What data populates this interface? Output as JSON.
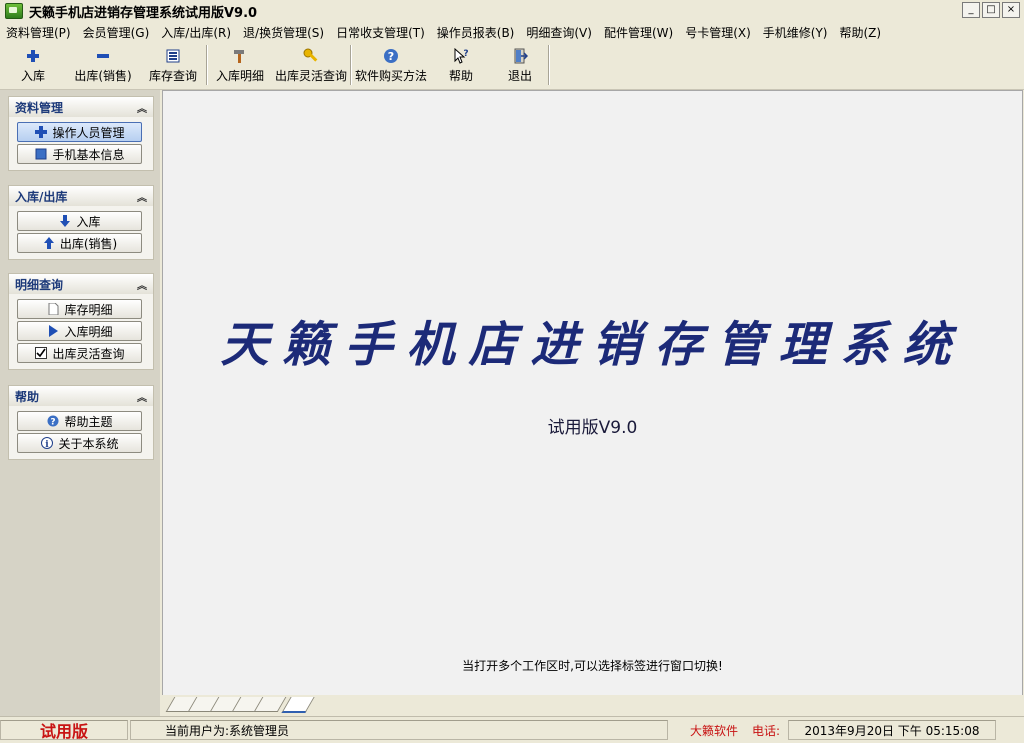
{
  "window": {
    "title": "天籁手机店进销存管理系统试用版V9.0",
    "controls": [
      "_",
      "□",
      "×"
    ]
  },
  "menu": {
    "items": [
      "资料管理(P)",
      "会员管理(G)",
      "入库/出库(R)",
      "退/换货管理(S)",
      "日常收支管理(T)",
      "操作员报表(B)",
      "明细查询(V)",
      "配件管理(W)",
      "号卡管理(X)",
      "手机维修(Y)",
      "帮助(Z)"
    ]
  },
  "toolbar": {
    "buttons": [
      {
        "label": "入库",
        "icon": "plus-icon"
      },
      {
        "label": "出库(销售)",
        "icon": "minus-icon"
      },
      {
        "label": "库存查询",
        "icon": "list-icon"
      },
      {
        "label": "入库明细",
        "icon": "hammer-icon"
      },
      {
        "label": "出库灵活查询",
        "icon": "key-icon"
      },
      {
        "label": "软件购买方法",
        "icon": "help-circle-icon"
      },
      {
        "label": "帮助",
        "icon": "cursor-help-icon"
      },
      {
        "label": "退出",
        "icon": "exit-icon"
      }
    ]
  },
  "sidebar": {
    "panels": [
      {
        "title": "资料管理",
        "items": [
          {
            "label": "操作人员管理",
            "icon": "plus-icon"
          },
          {
            "label": "手机基本信息",
            "icon": "square-icon"
          }
        ]
      },
      {
        "title": "入库/出库",
        "items": [
          {
            "label": "入库",
            "icon": "arrow-down-icon"
          },
          {
            "label": "出库(销售)",
            "icon": "arrow-up-icon"
          }
        ]
      },
      {
        "title": "明细查询",
        "items": [
          {
            "label": "库存明细",
            "icon": "document-icon"
          },
          {
            "label": "入库明细",
            "icon": "arrow-right-icon"
          },
          {
            "label": "出库灵活查询",
            "icon": "checkbox-icon"
          }
        ]
      },
      {
        "title": "帮助",
        "items": [
          {
            "label": "帮助主题",
            "icon": "help-circle-icon"
          },
          {
            "label": "关于本系统",
            "icon": "info-icon"
          }
        ]
      }
    ]
  },
  "main": {
    "title": "天籁手机店进销存管理系统",
    "version": "试用版V9.0",
    "hint": "当打开多个工作区时,可以选择标签进行窗口切换!"
  },
  "status": {
    "trial": "试用版",
    "user": "当前用户为:系统管理员",
    "company": "大籁软件",
    "phone_label": "电话:",
    "datetime": "2013年9月20日  下午  05:15:08"
  },
  "colors": {
    "title_blue": "#1c2a78",
    "status_red": "#c81414",
    "accent_blue": "#2f5fb0"
  }
}
